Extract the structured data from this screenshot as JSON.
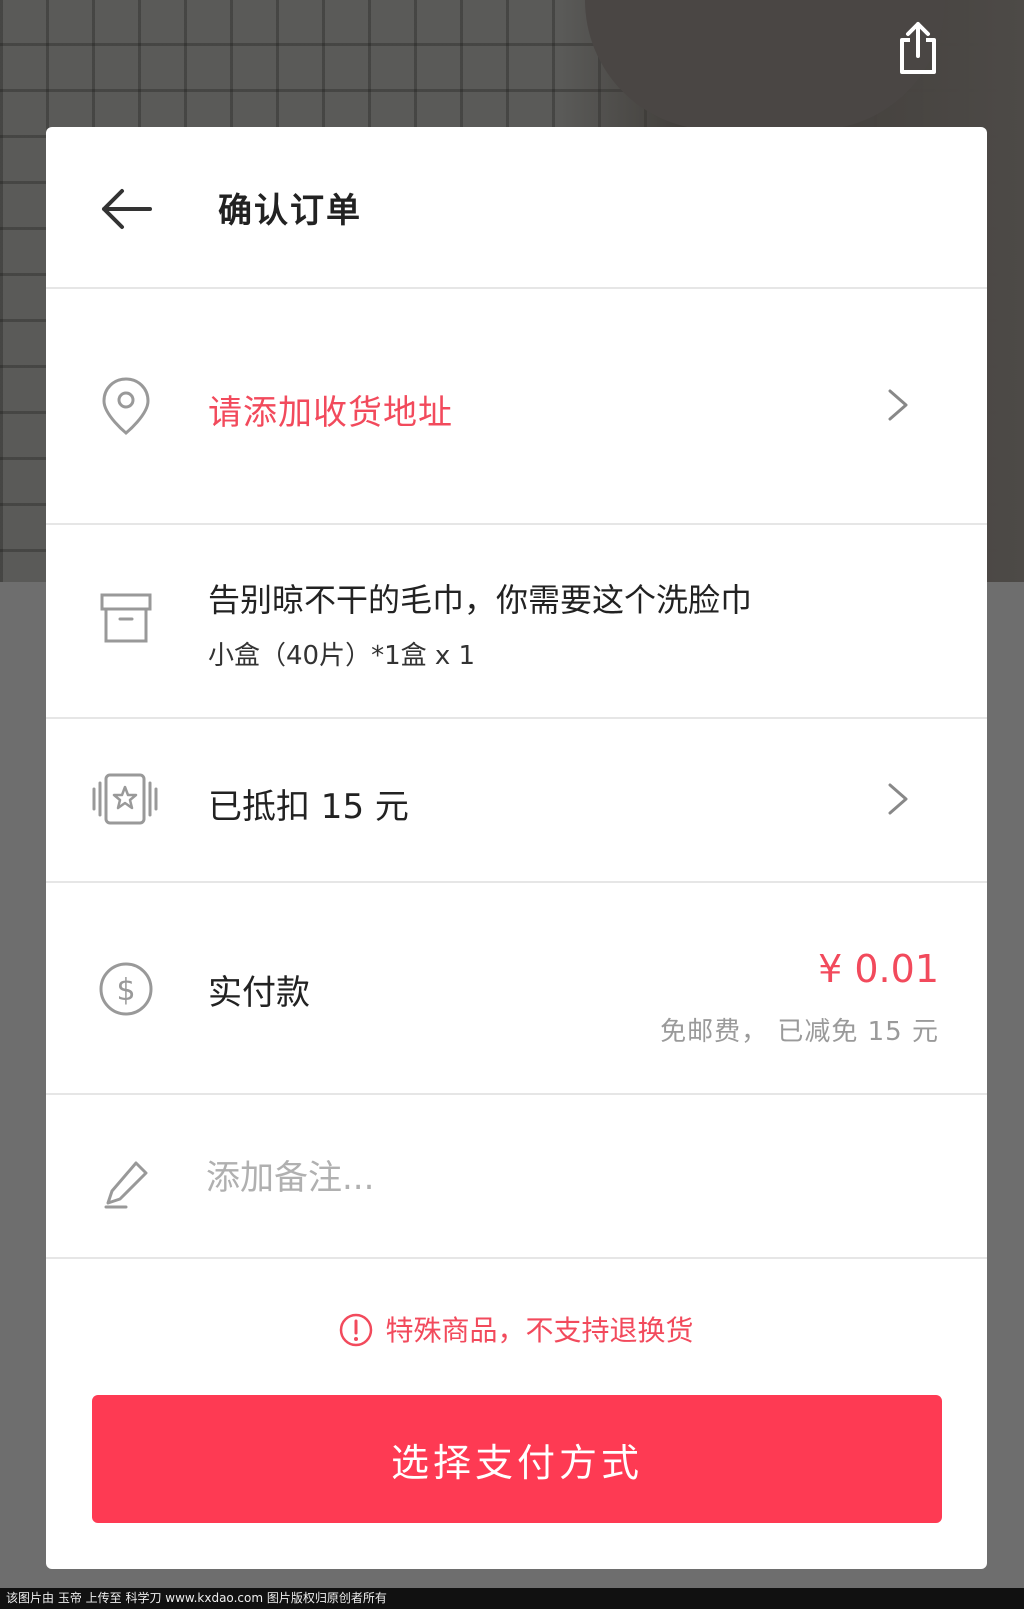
{
  "header": {
    "title": "确认订单"
  },
  "address": {
    "prompt": "请添加收货地址"
  },
  "product": {
    "name": "告别晾不干的毛巾，你需要这个洗脸巾",
    "sku": "小盒（40片）*1盒 x 1"
  },
  "coupon": {
    "text": "已抵扣 15 元"
  },
  "payment": {
    "label": "实付款",
    "amount": "¥ 0.01",
    "note": "免邮费， 已减免 15 元"
  },
  "remark": {
    "placeholder": "添加备注..."
  },
  "warning": {
    "text": "特殊商品，不支持退换货"
  },
  "pay_button": {
    "label": "选择支付方式"
  },
  "watermark": {
    "text": "该图片由 玉帝 上传至 科学刀 www.kxdao.com 图片版权归原创者所有"
  },
  "colors": {
    "accent": "#f24a5c",
    "button": "#fe3a53",
    "muted": "#9a9a9a"
  },
  "icons": [
    "share-icon",
    "back-arrow-icon",
    "location-pin-icon",
    "chevron-right-icon",
    "box-icon",
    "coupon-icon",
    "dollar-icon",
    "pencil-icon",
    "warning-icon"
  ]
}
